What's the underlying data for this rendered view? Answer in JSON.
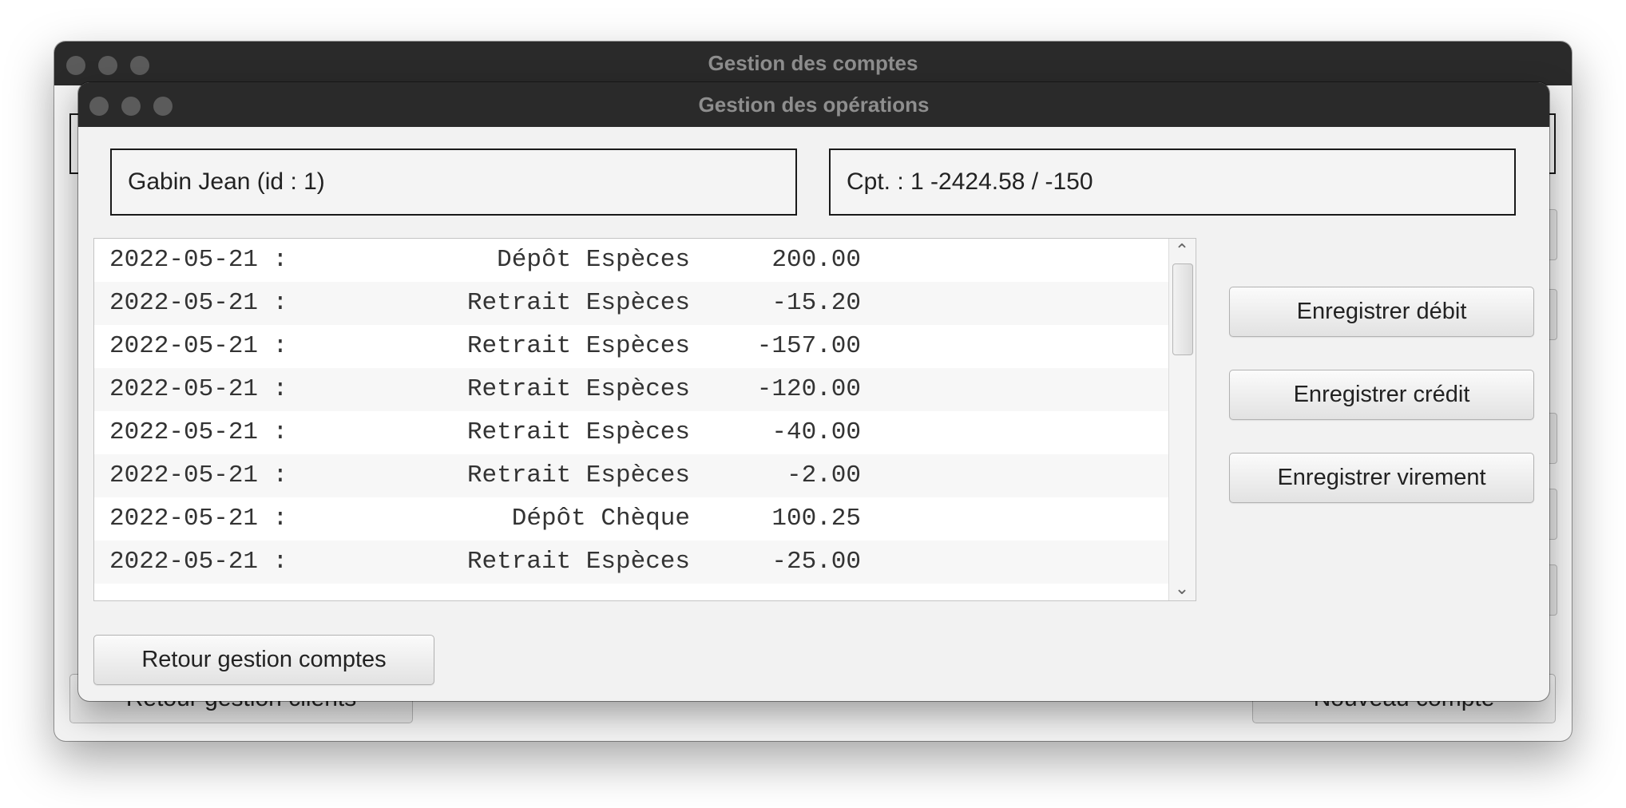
{
  "back_window": {
    "title": "Gestion des comptes",
    "bottom_left_button": "Retour gestion clients",
    "bottom_right_button": "Nouveau compte"
  },
  "front_window": {
    "title": "Gestion des opérations",
    "client_info": "Gabin Jean (id : 1)",
    "account_info": "Cpt. : 1  -2424.58  /  -150",
    "operations": [
      {
        "date": "2022-05-21 :",
        "label": "Dépôt Espèces",
        "amount": "200.00"
      },
      {
        "date": "2022-05-21 :",
        "label": "Retrait Espèces",
        "amount": "-15.20"
      },
      {
        "date": "2022-05-21 :",
        "label": "Retrait Espèces",
        "amount": "-157.00"
      },
      {
        "date": "2022-05-21 :",
        "label": "Retrait Espèces",
        "amount": "-120.00"
      },
      {
        "date": "2022-05-21 :",
        "label": "Retrait Espèces",
        "amount": "-40.00"
      },
      {
        "date": "2022-05-21 :",
        "label": "Retrait Espèces",
        "amount": "-2.00"
      },
      {
        "date": "2022-05-21 :",
        "label": "Dépôt Chèque",
        "amount": "100.25"
      },
      {
        "date": "2022-05-21 :",
        "label": "Retrait Espèces",
        "amount": "-25.00"
      }
    ],
    "buttons": {
      "debit": "Enregistrer débit",
      "credit": "Enregistrer crédit",
      "transfer": "Enregistrer virement",
      "back": "Retour gestion comptes"
    },
    "scroll_up_icon": "chevron-up-icon",
    "scroll_down_icon": "chevron-down-icon"
  }
}
